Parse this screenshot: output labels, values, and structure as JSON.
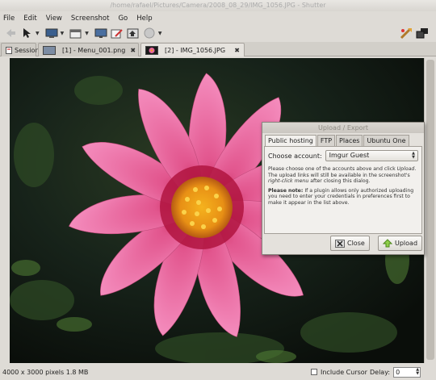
{
  "window": {
    "title": "/home/rafael/Pictures/Camera/2008_08_29/IMG_1056.JPG - Shutter"
  },
  "menu": [
    "File",
    "Edit",
    "View",
    "Screenshot",
    "Go",
    "Help"
  ],
  "tabs": [
    {
      "label": "Session"
    },
    {
      "label": "[1] - Menu_001.png"
    },
    {
      "label": "[2] - IMG_1056.JPG"
    }
  ],
  "status": {
    "info": "4000 x 3000 pixels  1.8 MB",
    "include_cursor_label": "Include Cursor",
    "delay_label": "Delay:",
    "delay_value": "0"
  },
  "dialog": {
    "title": "Upload / Export",
    "tabs": [
      "Public hosting",
      "FTP",
      "Places",
      "Ubuntu One"
    ],
    "account_label": "Choose account:",
    "account_value": "Imgur Guest",
    "desc_prefix": "Please choose one of the accounts above and click ",
    "desc_upload": "Upload",
    "desc_mid": ". The upload links will still be available in the screenshot's ",
    "desc_menu": "right-click menu",
    "desc_suffix": " after closing this dialog.",
    "note_label": "Please note:",
    "note_text": " If a plugin allows only authorized uploading you need to enter your credentials in preferences first to make it appear in the list above.",
    "close_label": "Close",
    "upload_label": "Upload"
  },
  "colors": {
    "petal": "#e8679f",
    "center": "#f1a51c",
    "background": "#0f1410"
  }
}
